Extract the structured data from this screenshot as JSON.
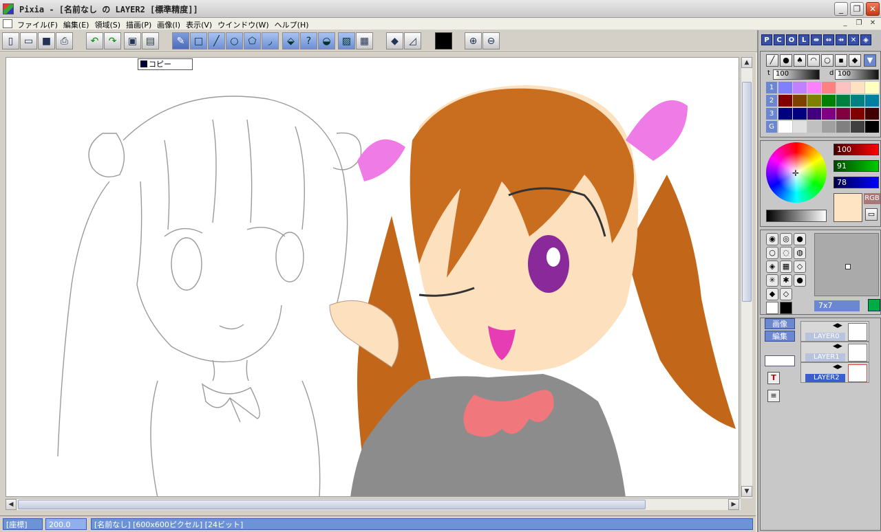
{
  "window": {
    "title": "Pixia - [名前なし の LAYER2 [標準精度]]",
    "min_icon": "minimize-icon",
    "max_icon": "maximize-icon",
    "close_icon": "close-icon"
  },
  "menubar": {
    "items": [
      "ファイル(F)",
      "編集(E)",
      "領域(S)",
      "描画(P)",
      "画像(I)",
      "表示(V)",
      "ウインドウ(W)",
      "ヘルプ(H)"
    ]
  },
  "toolbar": {
    "tools": [
      "new-file-icon",
      "open-file-icon",
      "save-icon",
      "print-icon",
      "undo-icon",
      "redo-icon",
      "copy-icon",
      "paste-icon",
      "pen-tool-icon",
      "rectangle-tool-icon",
      "line-tool-icon",
      "circle-tool-icon",
      "polygon-tool-icon",
      "curve-tool-icon",
      "fill-tool-icon",
      "magic-wand-icon",
      "blend-icon",
      "select-icon",
      "mosaic-icon",
      "eraser-icon",
      "ruler-icon",
      "current-color-icon",
      "zoom-in-icon",
      "zoom-out-icon"
    ]
  },
  "canvas": {
    "layer_label": "コピー"
  },
  "statusbar": {
    "mode": "[座標]",
    "zoom": "200.0",
    "info": "[名前なし] [600x600ピクセル] [24ビット]"
  },
  "palette": {
    "tabs": [
      "P",
      "C",
      "O",
      "L"
    ],
    "thickness_label": "t",
    "thickness_value": "100",
    "density_label": "d",
    "density_value": "100",
    "row_labels": [
      "1",
      "2",
      "3",
      "G"
    ],
    "rows": [
      [
        "#8080ff",
        "#c080ff",
        "#ff80ff",
        "#ff8080",
        "#ffc0c0",
        "#ffe0c0",
        "#ffffc0"
      ],
      [
        "#800000",
        "#804000",
        "#808000",
        "#008000",
        "#008040",
        "#008080",
        "#0080a0"
      ],
      [
        "#000080",
        "#000080",
        "#400080",
        "#800080",
        "#800040",
        "#800000",
        "#400000"
      ],
      [
        "#ffffff",
        "#e0e0e0",
        "#c0c0c0",
        "#a0a0a0",
        "#808080",
        "#404040",
        "#000000"
      ]
    ]
  },
  "colorpicker": {
    "r": "100",
    "g": "91",
    "b": "78",
    "mode_label": "RGB",
    "current_color": "#ffe4c4"
  },
  "brush": {
    "size_label": "7x7"
  },
  "layers": {
    "tabs": [
      "画像",
      "編集"
    ],
    "items": [
      {
        "name": "LAYER0",
        "active": false
      },
      {
        "name": "LAYER1",
        "active": false
      },
      {
        "name": "LAYER2",
        "active": true
      }
    ]
  }
}
